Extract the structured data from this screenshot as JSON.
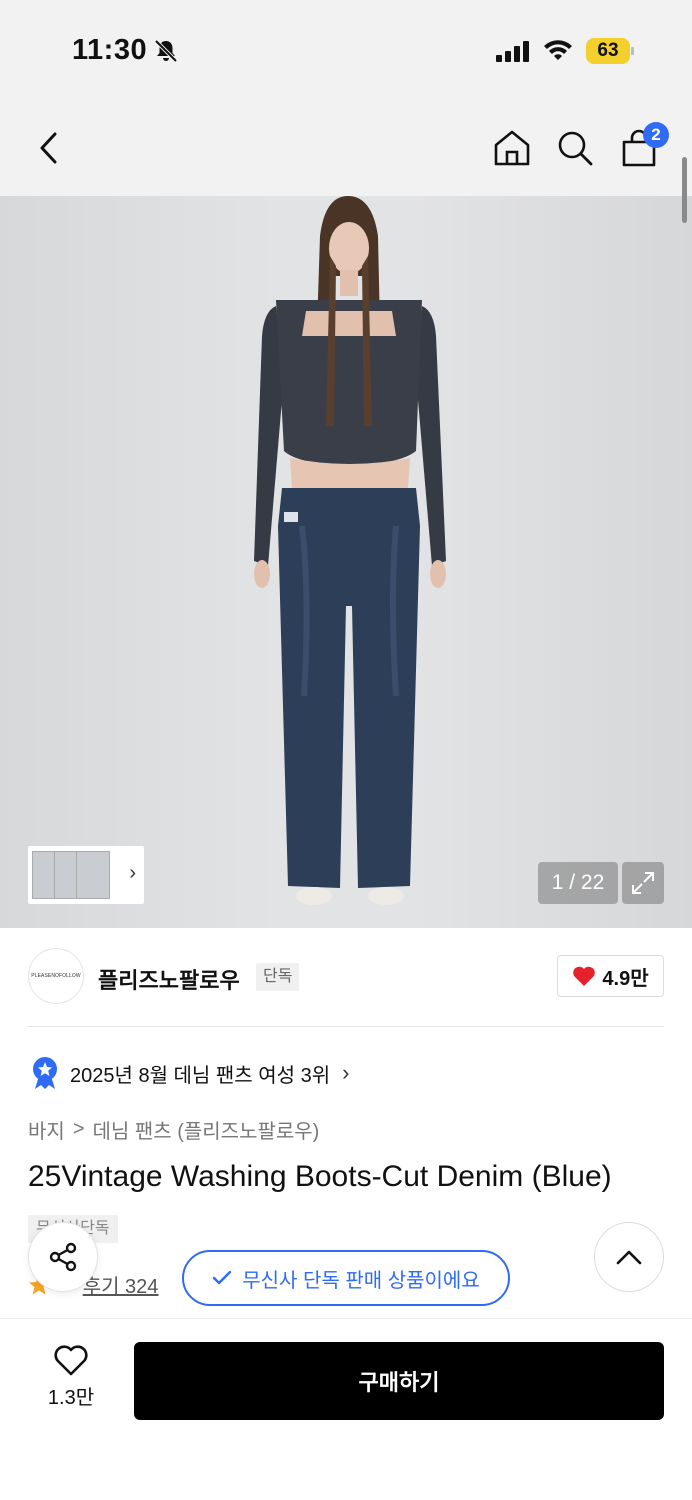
{
  "status_bar": {
    "time": "11:30",
    "battery": "63",
    "icons": [
      "bell-slash-icon",
      "signal-icon",
      "wifi-icon",
      "battery-icon"
    ]
  },
  "header": {
    "icons": [
      "chevron-left-icon",
      "home-icon",
      "search-icon",
      "bag-icon"
    ],
    "cart_badge": "2"
  },
  "gallery": {
    "counter": "1 / 22",
    "thumbnail_arrow": "›"
  },
  "brand": {
    "logo_text": "PLEASENOFOLLOW",
    "name": "플리즈노팔로우",
    "tag": "단독",
    "likes": "4.9만"
  },
  "ranking": {
    "text": "2025년 8월 데님 팬츠 여성 3위",
    "chevron": "›"
  },
  "breadcrumb": {
    "level1": "바지",
    "separator": ">",
    "level2": "데님 팬츠 (플리즈노팔로우)"
  },
  "product": {
    "title": "25Vintage Washing Boots-Cut Denim (Blue)",
    "exclusive_tag": "무신사단독",
    "rating": ".9",
    "review_label": "후기 324"
  },
  "toast": {
    "text": "무신사 단독 판매 상품이에요"
  },
  "bottom_bar": {
    "wish_count": "1.3만",
    "buy_label": "구매하기"
  },
  "colors": {
    "accent_blue": "#2f6bf5",
    "buy_button": "#000000",
    "heart": "#e5222b",
    "battery": "#f4d02c"
  }
}
